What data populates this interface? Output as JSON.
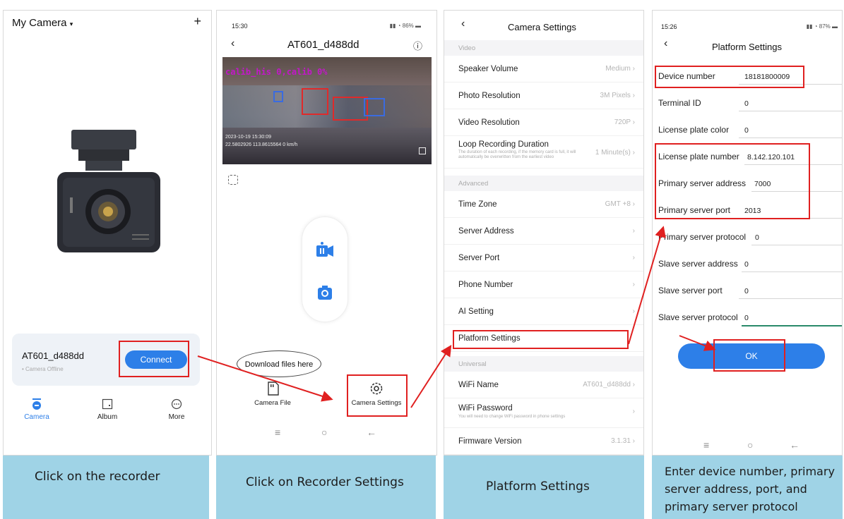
{
  "panel1": {
    "title": "My Camera",
    "title_caret": "▾",
    "add_icon": "+",
    "device_name": "AT601_d488dd",
    "device_status": "Camera Offline",
    "connect_label": "Connect",
    "nav": [
      {
        "label": "Camera",
        "icon": "camera-tab-icon"
      },
      {
        "label": "Album",
        "icon": "album-icon"
      },
      {
        "label": "More",
        "icon": "more-icon"
      }
    ],
    "caption": "Click on the recorder"
  },
  "panel2": {
    "time": "15:30",
    "status_right": "86%",
    "title": "AT601_d488dd",
    "overlay_text": "calib_his 0,calib 0%",
    "video_date": "2023-10-19  15:30:09",
    "video_coords": "22.5802926  113.8615564   0 km/h",
    "download_hint": "Download files here",
    "camera_file_label": "Camera File",
    "camera_settings_label": "Camera Settings",
    "caption": "Click on Recorder Settings"
  },
  "panel3": {
    "title": "Camera Settings",
    "sections": {
      "video": "Video",
      "advanced": "Advanced",
      "universal": "Universal"
    },
    "video_rows": [
      {
        "label": "Speaker Volume",
        "value": "Medium"
      },
      {
        "label": "Photo Resolution",
        "value": "3M Pixels"
      },
      {
        "label": "Video Resolution",
        "value": "720P"
      }
    ],
    "loop": {
      "label": "Loop Recording Duration",
      "desc": "The duration of each recording, if the memory card is full, it will automatically be overwritten from the earliest video",
      "value": "1 Minute(s)"
    },
    "advanced_rows": [
      {
        "label": "Time Zone",
        "value": "GMT +8"
      },
      {
        "label": "Server Address",
        "value": ""
      },
      {
        "label": "Server Port",
        "value": ""
      },
      {
        "label": "Phone Number",
        "value": ""
      },
      {
        "label": "AI Setting",
        "value": ""
      },
      {
        "label": "Platform Settings",
        "value": ""
      }
    ],
    "wifi_name": {
      "label": "WiFi Name",
      "value": "AT601_d488dd"
    },
    "wifi_password": {
      "label": "WiFi Password",
      "desc": "You will need to change WiFi password in phone settings"
    },
    "firmware": {
      "label": "Firmware Version",
      "value": "3.1.31"
    },
    "caption": "Platform Settings"
  },
  "panel4": {
    "time": "15:26",
    "status_right": "87%",
    "title": "Platform Settings",
    "fields": [
      {
        "label": "Device number",
        "value": "18181800009"
      },
      {
        "label": "Terminal ID",
        "value": "0"
      },
      {
        "label": "License plate color",
        "value": "0"
      },
      {
        "label": "License plate number",
        "value": "8.142.120.101"
      },
      {
        "label": "Primary server address",
        "value": "7000"
      },
      {
        "label": "Primary server port",
        "value": "2013"
      },
      {
        "label": "Primary server protocol",
        "value": "0"
      },
      {
        "label": "Slave server address",
        "value": "0"
      },
      {
        "label": "Slave server port",
        "value": "0"
      },
      {
        "label": "Slave server protocol",
        "value": "0"
      }
    ],
    "ok_label": "OK",
    "caption": "Enter device number, primary server address, port, and primary server protocol"
  },
  "colors": {
    "accent": "#2d7fe8",
    "annotation_red": "#e02020",
    "caption_bg": "#9fd3e6"
  }
}
